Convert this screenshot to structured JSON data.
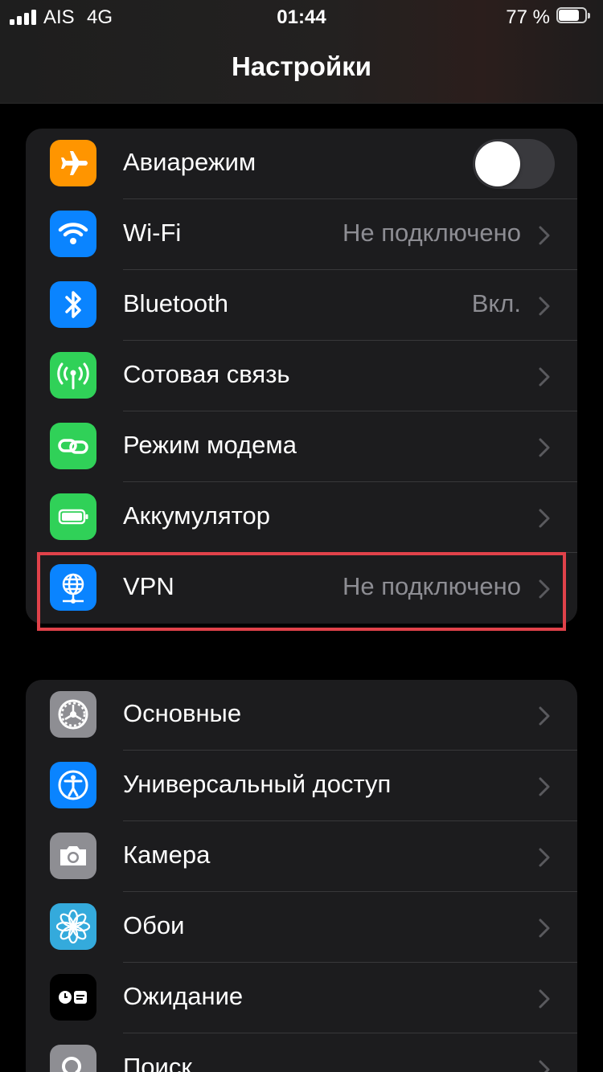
{
  "status_bar": {
    "carrier": "AIS",
    "network": "4G",
    "time": "01:44",
    "battery_percent_label": "77 %",
    "battery_level": 0.77
  },
  "nav": {
    "title": "Настройки"
  },
  "group1": [
    {
      "label": "Авиарежим",
      "icon": "airplane-icon",
      "color": "#ff9500",
      "control": "toggle",
      "toggle_on": false
    },
    {
      "label": "Wi-Fi",
      "value": "Не подключено",
      "icon": "wifi-icon",
      "color": "#0a84ff"
    },
    {
      "label": "Bluetooth",
      "value": "Вкл.",
      "icon": "bluetooth-icon",
      "color": "#0a84ff"
    },
    {
      "label": "Сотовая связь",
      "icon": "cellular-antenna-icon",
      "color": "#30d158"
    },
    {
      "label": "Режим модема",
      "icon": "personal-hotspot-icon",
      "color": "#30d158"
    },
    {
      "label": "Аккумулятор",
      "icon": "battery-icon",
      "color": "#30d158"
    },
    {
      "label": "VPN",
      "value": "Не подключено",
      "icon": "vpn-globe-icon",
      "color": "#0a84ff",
      "highlighted": true
    }
  ],
  "group2": [
    {
      "label": "Основные",
      "icon": "gear-icon",
      "color": "#8e8e93"
    },
    {
      "label": "Универсальный доступ",
      "icon": "accessibility-icon",
      "color": "#0a84ff"
    },
    {
      "label": "Камера",
      "icon": "camera-icon",
      "color": "#8e8e93"
    },
    {
      "label": "Обои",
      "icon": "wallpaper-flower-icon",
      "color": "#34aadc"
    },
    {
      "label": "Ожидание",
      "icon": "standby-icon",
      "color": "#000000"
    },
    {
      "label": "Поиск",
      "icon": "search-icon",
      "color": "#8e8e93"
    }
  ],
  "colors": {
    "background": "#000000",
    "cell": "#1c1c1e",
    "separator": "#38383a",
    "secondary_text": "#8d8d93",
    "highlight_border": "#e0424a"
  }
}
